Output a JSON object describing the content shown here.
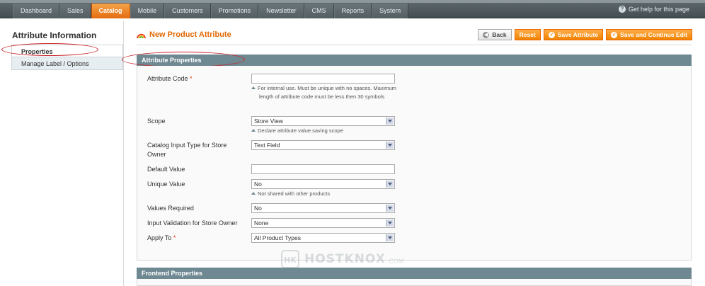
{
  "nav": {
    "items": [
      "Dashboard",
      "Sales",
      "Catalog",
      "Mobile",
      "Customers",
      "Promotions",
      "Newsletter",
      "CMS",
      "Reports",
      "System"
    ],
    "active": "Catalog",
    "help": "Get help for this page"
  },
  "sidebar": {
    "title": "Attribute Information",
    "tabs": [
      "Properties",
      "Manage Label / Options"
    ]
  },
  "header": {
    "title": "New Product Attribute",
    "buttons": {
      "back": "Back",
      "reset": "Reset",
      "save": "Save Attribute",
      "save_continue": "Save and Continue Edit"
    }
  },
  "section": {
    "title": "Attribute Properties",
    "fields": {
      "attribute_code": {
        "label": "Attribute Code",
        "value": "",
        "note": "For internal use. Must be unique with no spaces. Maximum length of attribute code must be less then 30 symbols"
      },
      "scope": {
        "label": "Scope",
        "value": "Store View",
        "note": "Declare attribute value saving scope"
      },
      "input_type": {
        "label": "Catalog Input Type for Store Owner",
        "value": "Text Field"
      },
      "default_value": {
        "label": "Default Value",
        "value": ""
      },
      "unique_value": {
        "label": "Unique Value",
        "value": "No",
        "note": "Not shared with other products"
      },
      "values_required": {
        "label": "Values Required",
        "value": "No"
      },
      "input_validation": {
        "label": "Input Validation for Store Owner",
        "value": "None"
      },
      "apply_to": {
        "label": "Apply To",
        "value": "All Product Types"
      }
    }
  },
  "frontend": {
    "title": "Frontend Properties"
  },
  "watermark": {
    "brand": "HOSTKNOX",
    "suffix": ".COM",
    "logo_letters": "HK"
  },
  "colors": {
    "accent": "#e26703",
    "section_header": "#6f8992",
    "annotation": "#c9252b"
  }
}
